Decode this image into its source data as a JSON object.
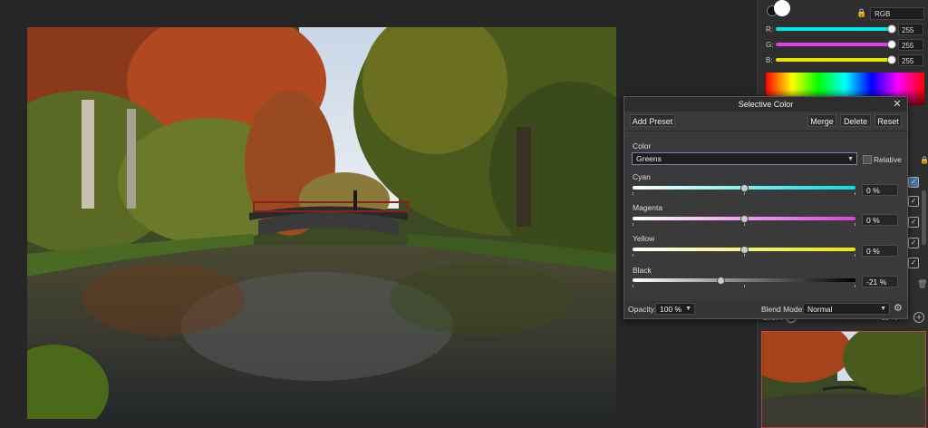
{
  "color_panel": {
    "mode": "RGB",
    "channels": [
      {
        "label": "R:",
        "value": "255",
        "color": "#00e5e5"
      },
      {
        "label": "G:",
        "value": "255",
        "color": "#e040e0"
      },
      {
        "label": "B:",
        "value": "255",
        "color": "#e5e500"
      }
    ]
  },
  "zoom_panel": {
    "label": "Zoom:",
    "value": "13 %"
  },
  "dialog": {
    "title": "Selective Color",
    "add_preset": "Add Preset",
    "merge": "Merge",
    "delete": "Delete",
    "reset": "Reset",
    "color_label": "Color",
    "color_value": "Greens",
    "relative_label": "Relative",
    "sliders": [
      {
        "label": "Cyan",
        "value": "0 %",
        "fraction": 0.5,
        "color": "#00e0e0"
      },
      {
        "label": "Magenta",
        "value": "0 %",
        "fraction": 0.5,
        "color": "#e040e0"
      },
      {
        "label": "Yellow",
        "value": "0 %",
        "fraction": 0.5,
        "color": "#e8e800"
      },
      {
        "label": "Black",
        "value": "-21 %",
        "fraction": 0.395,
        "color": "#000000"
      }
    ],
    "opacity_label": "Opacity:",
    "opacity_value": "100 %",
    "blend_label": "Blend Mode:",
    "blend_value": "Normal"
  }
}
